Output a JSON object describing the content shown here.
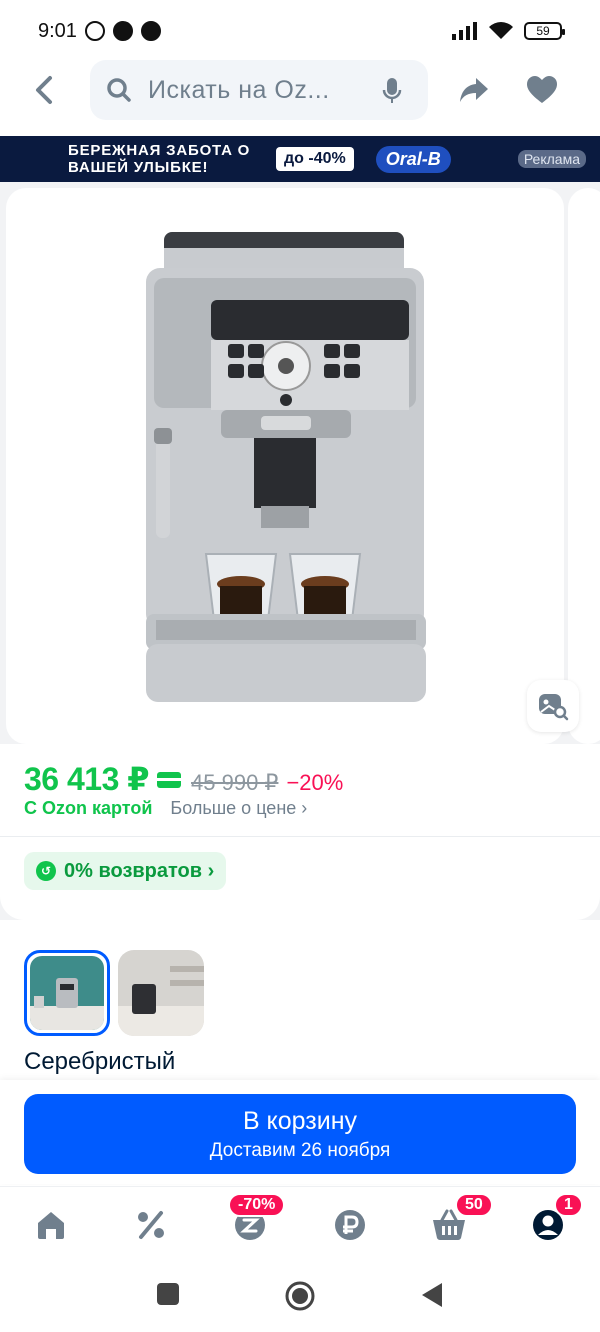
{
  "status_bar": {
    "time": "9:01",
    "battery": "59"
  },
  "header": {
    "search_placeholder": "Искать на Oz..."
  },
  "banner": {
    "text": "БЕРЕЖНАЯ ЗАБОТА О ВАШЕЙ УЛЫБКЕ!",
    "discount": "до -40%",
    "brand": "Oral-B",
    "ad_label": "Реклама"
  },
  "product": {
    "price": "36 413 ₽",
    "old_price": "45 990 ₽",
    "discount": "−20%",
    "ozon_card_label": "С Ozon картой",
    "price_more": "Больше о цене ›",
    "returns": "0% возвратов ›",
    "color_label": "Серебристый"
  },
  "cart": {
    "title": "В корзину",
    "subtitle": "Доставим 26 ноября"
  },
  "bottom_nav": {
    "items": [
      {
        "name": "home-icon"
      },
      {
        "name": "percent-icon"
      },
      {
        "name": "fresh-icon",
        "badge": "-70%"
      },
      {
        "name": "ruble-icon"
      },
      {
        "name": "cart-icon",
        "badge": "50"
      },
      {
        "name": "profile-icon",
        "badge": "1"
      }
    ]
  },
  "colors": {
    "accent_blue": "#005bff",
    "price_green": "#10c44c",
    "discount_red": "#f91155"
  }
}
